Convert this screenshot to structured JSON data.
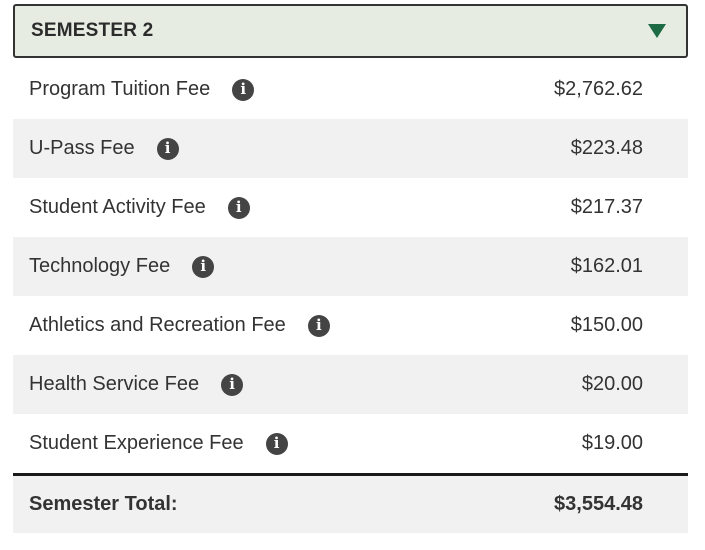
{
  "header": {
    "title": "SEMESTER 2",
    "toggle_icon": "triangle-down-icon",
    "accent_color": "#1c6b45",
    "background_color": "#e7ece3"
  },
  "fees": [
    {
      "label": "Program Tuition Fee",
      "amount": "$2,762.62",
      "icon": "info-icon"
    },
    {
      "label": "U-Pass Fee",
      "amount": "$223.48",
      "icon": "info-icon"
    },
    {
      "label": "Student Activity Fee",
      "amount": "$217.37",
      "icon": "info-icon"
    },
    {
      "label": "Technology Fee",
      "amount": "$162.01",
      "icon": "info-icon"
    },
    {
      "label": "Athletics and Recreation Fee",
      "amount": "$150.00",
      "icon": "info-icon"
    },
    {
      "label": "Health Service Fee",
      "amount": "$20.00",
      "icon": "info-icon"
    },
    {
      "label": "Student Experience Fee",
      "amount": "$19.00",
      "icon": "info-icon"
    }
  ],
  "total": {
    "label": "Semester Total:",
    "amount": "$3,554.48"
  }
}
